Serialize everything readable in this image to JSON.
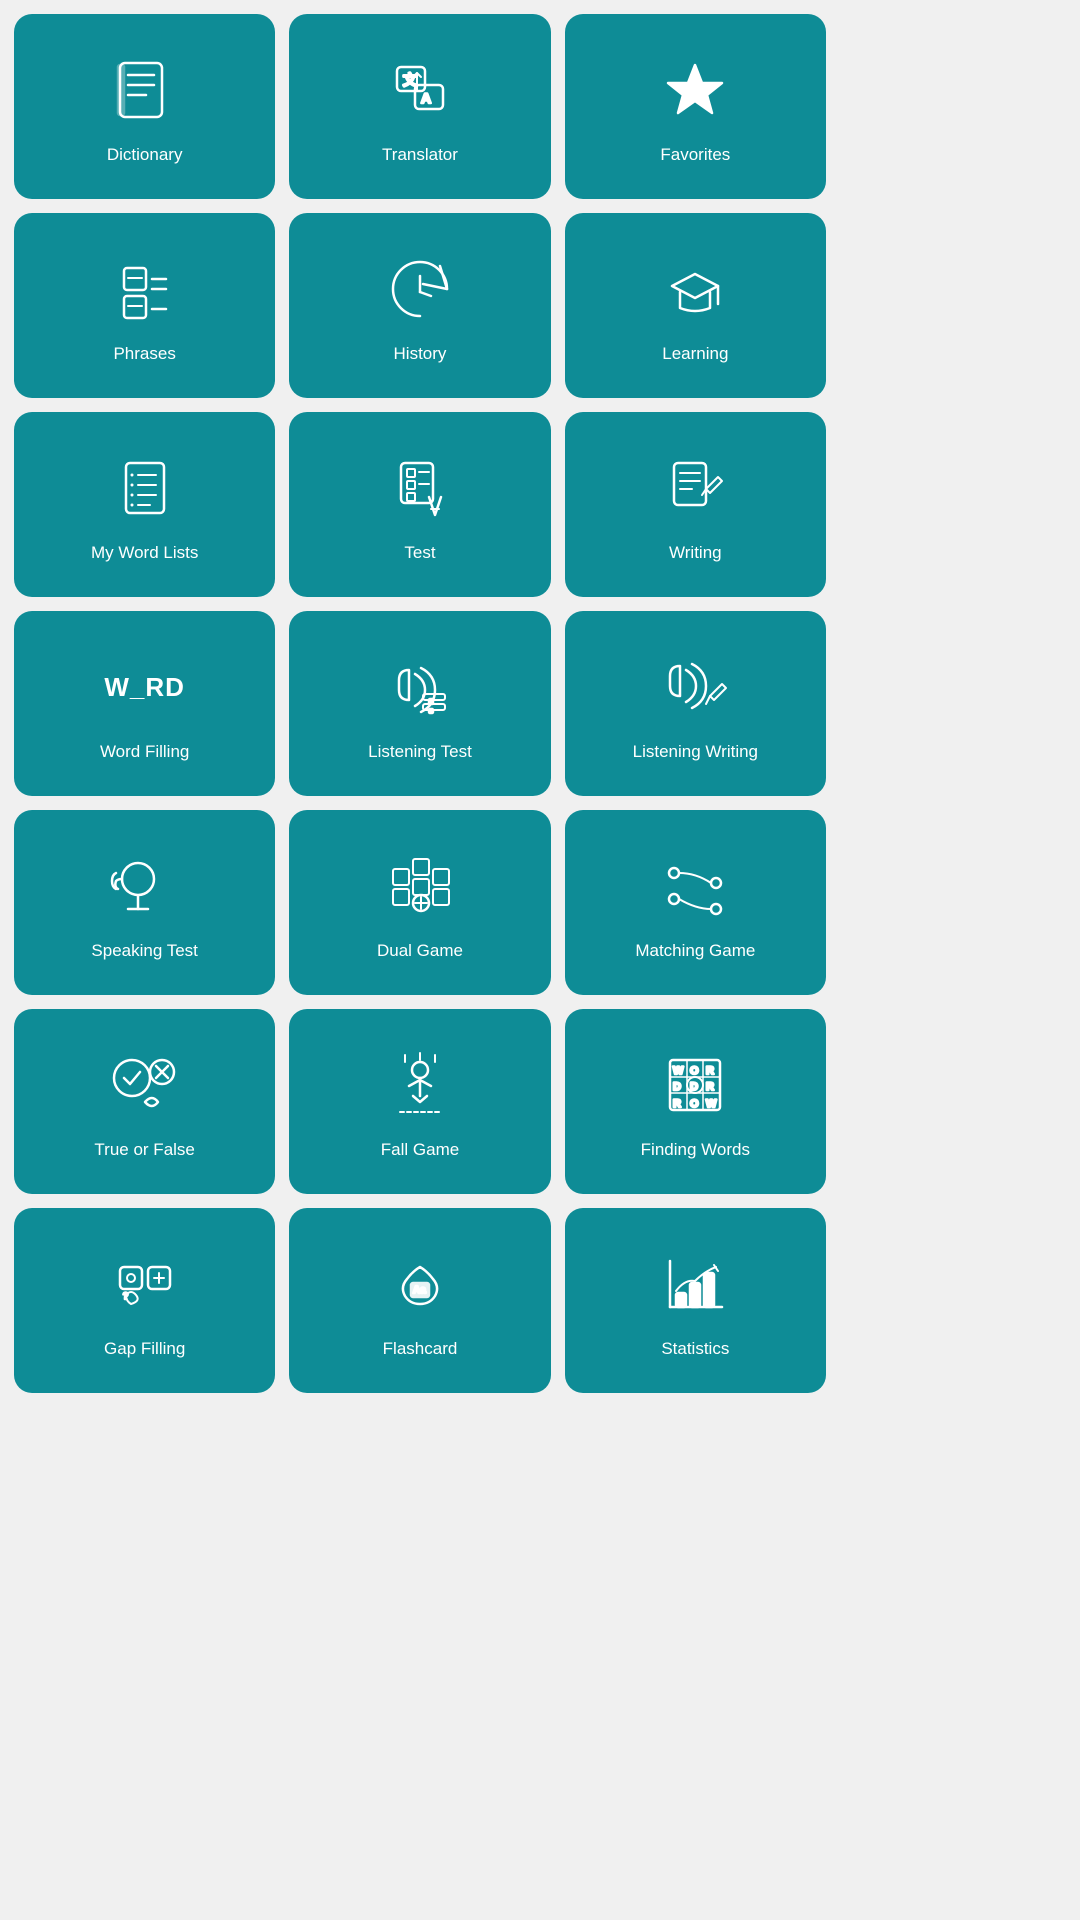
{
  "tiles": [
    {
      "id": "dictionary",
      "label": "Dictionary",
      "icon": "dictionary"
    },
    {
      "id": "translator",
      "label": "Translator",
      "icon": "translator"
    },
    {
      "id": "favorites",
      "label": "Favorites",
      "icon": "favorites"
    },
    {
      "id": "phrases",
      "label": "Phrases",
      "icon": "phrases"
    },
    {
      "id": "history",
      "label": "History",
      "icon": "history"
    },
    {
      "id": "learning",
      "label": "Learning",
      "icon": "learning"
    },
    {
      "id": "my-word-lists",
      "label": "My Word Lists",
      "icon": "wordlists"
    },
    {
      "id": "test",
      "label": "Test",
      "icon": "test"
    },
    {
      "id": "writing",
      "label": "Writing",
      "icon": "writing"
    },
    {
      "id": "word-filling",
      "label": "Word Filling",
      "icon": "wordfilling"
    },
    {
      "id": "listening-test",
      "label": "Listening Test",
      "icon": "listeningtest"
    },
    {
      "id": "listening-writing",
      "label": "Listening Writing",
      "icon": "listeningwriting"
    },
    {
      "id": "speaking-test",
      "label": "Speaking Test",
      "icon": "speaking"
    },
    {
      "id": "dual-game",
      "label": "Dual Game",
      "icon": "dualgame"
    },
    {
      "id": "matching-game",
      "label": "Matching Game",
      "icon": "matching"
    },
    {
      "id": "true-or-false",
      "label": "True or False",
      "icon": "truefalse"
    },
    {
      "id": "fall-game",
      "label": "Fall Game",
      "icon": "fallgame"
    },
    {
      "id": "finding-words",
      "label": "Finding Words",
      "icon": "findingwords"
    },
    {
      "id": "gap-filling",
      "label": "Gap Filling",
      "icon": "gapfilling"
    },
    {
      "id": "flashcard",
      "label": "Flashcard",
      "icon": "flashcard"
    },
    {
      "id": "statistics",
      "label": "Statistics",
      "icon": "statistics"
    }
  ]
}
